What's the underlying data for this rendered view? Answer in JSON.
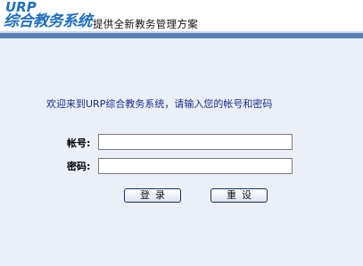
{
  "header": {
    "logo_brand": "URP",
    "logo_name": "综合教务系统",
    "tagline": "提供全新教务管理方案"
  },
  "login": {
    "welcome": "欢迎来到URP综合教务系统，请输入您的帐号和密码",
    "account_label": "帐号:",
    "account_value": "",
    "password_label": "密码:",
    "password_value": "",
    "login_button": "登录",
    "reset_button": "重设"
  },
  "colors": {
    "page_background": "#ebeff8",
    "brand_blue": "#1d6fc2",
    "header_bar": "#5b80b8",
    "welcome_text": "#1a2c8c"
  }
}
